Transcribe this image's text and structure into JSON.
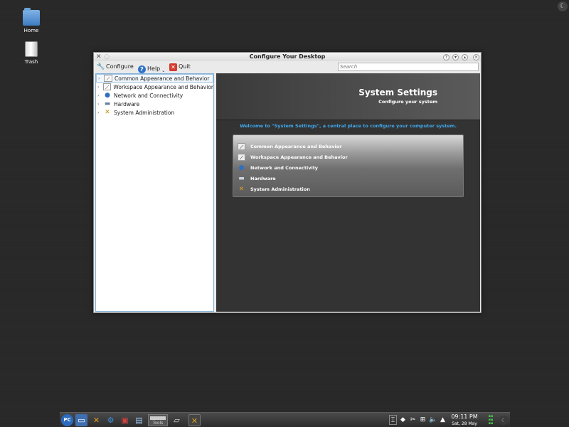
{
  "desktop": {
    "icons": [
      {
        "label": "Home",
        "icon": "home-folder-icon"
      },
      {
        "label": "Trash",
        "icon": "trash-icon"
      }
    ]
  },
  "window": {
    "title": "Configure Your Desktop",
    "toolbar": {
      "configure_label": "Configure",
      "help_label": "Help",
      "quit_label": "Quit",
      "search_placeholder": "Search"
    },
    "tree": {
      "items": [
        {
          "label": "Common Appearance and Behavior",
          "icon": "appearance-icon"
        },
        {
          "label": "Workspace Appearance and Behavior",
          "icon": "workspace-icon"
        },
        {
          "label": "Network and Connectivity",
          "icon": "globe-icon"
        },
        {
          "label": "Hardware",
          "icon": "hardware-icon"
        },
        {
          "label": "System Administration",
          "icon": "tools-icon"
        }
      ]
    },
    "content": {
      "heading": "System Settings",
      "subheading": "Configure your system",
      "welcome": "Welcome to \"System Settings\", a central place to configure your computer system.",
      "categories": [
        {
          "label": "Common Appearance and Behavior",
          "icon": "appearance-icon"
        },
        {
          "label": "Workspace Appearance and Behavior",
          "icon": "workspace-icon"
        },
        {
          "label": "Network and Connectivity",
          "icon": "globe-icon"
        },
        {
          "label": "Hardware",
          "icon": "hardware-icon"
        },
        {
          "label": "System Administration",
          "icon": "tools-icon"
        }
      ]
    }
  },
  "taskbar": {
    "launcher": "PC",
    "pager_label": "Tools",
    "clock": {
      "time": "09:11 PM",
      "date": "Sat, 28 May"
    }
  },
  "colors": {
    "accent": "#3fa9ee",
    "tree_border": "#7eb0d8"
  }
}
